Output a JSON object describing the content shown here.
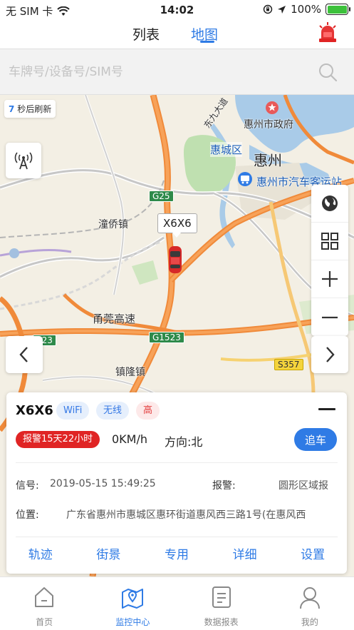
{
  "status_bar": {
    "carrier": "无 SIM 卡",
    "time": "14:02",
    "battery": "100%"
  },
  "header": {
    "tabs": [
      {
        "label": "列表"
      },
      {
        "label": "地图"
      }
    ]
  },
  "search": {
    "placeholder": "车牌号/设备号/SIM号"
  },
  "map": {
    "refresh_count": "7",
    "refresh_suffix": "秒后刷新",
    "car_label": "X6X6",
    "labels": {
      "city_gov": "惠州市政府",
      "huizhou": "惠州",
      "huicheng": "惠城区",
      "bus_station": "惠州市汽车客运站",
      "tongqiao": "潼侨镇",
      "yongguan": "甬莞高速",
      "zhenlong": "镇隆镇",
      "g25": "G25",
      "g1523": "G1523",
      "g1523_left": "523",
      "s357": "S357",
      "road_top": "东九大道"
    }
  },
  "vehicle": {
    "plate": "X6X6",
    "tags": {
      "wifi": "WiFi",
      "wireless": "无线",
      "high": "高"
    },
    "alarm_duration": "报警15天22小时",
    "speed": "0KM/h",
    "direction": "方向:北",
    "follow_label": "追车",
    "signal_label": "信号:",
    "signal_time": "2019-05-15 15:49:25",
    "alarm_label": "报警:",
    "alarm_value": "圆形区域报",
    "location_label": "位置:",
    "location_value": "广东省惠州市惠城区惠环街道惠风西三路1号(在惠风西",
    "actions": [
      {
        "label": "轨迹"
      },
      {
        "label": "街景"
      },
      {
        "label": "专用"
      },
      {
        "label": "详细"
      },
      {
        "label": "设置"
      }
    ]
  },
  "bottom_nav": [
    {
      "label": "首页"
    },
    {
      "label": "监控中心"
    },
    {
      "label": "数据报表"
    },
    {
      "label": "我的"
    }
  ],
  "colors": {
    "accent": "#2f7be5",
    "alarm": "#e02424",
    "highway": "#f08a3a"
  }
}
